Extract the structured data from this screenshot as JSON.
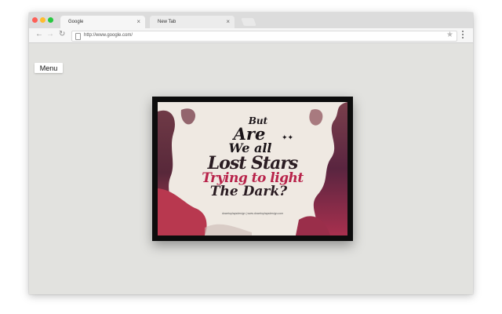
{
  "browser": {
    "tabs": [
      {
        "title": "Google",
        "close": "×"
      },
      {
        "title": "New Tab",
        "close": "×"
      }
    ],
    "address_bar": {
      "url": "http://www.google.com/"
    }
  },
  "page": {
    "menu_button": "Menu",
    "poster": {
      "line1": "But",
      "line2": "Are",
      "line3": "We all",
      "line4": "Lost Stars",
      "line5": "Trying to light",
      "line6": "The Dark?",
      "credit": "downtoplaysdesign | www.downtoplaysdesign.com"
    }
  },
  "colors": {
    "poster_accent": "#b8234a",
    "poster_ink": "#1a1418",
    "frame": "#0d0d0d"
  }
}
